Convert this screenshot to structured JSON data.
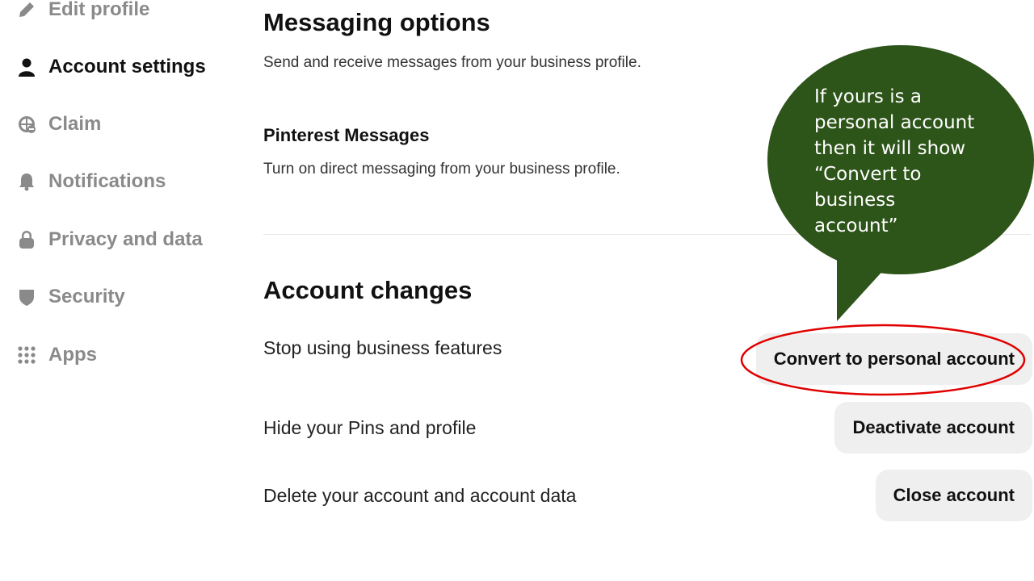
{
  "sidebar": {
    "items": [
      {
        "label": "Edit profile",
        "icon": "pencil-icon",
        "active": false
      },
      {
        "label": "Account settings",
        "icon": "person-icon",
        "active": true
      },
      {
        "label": "Claim",
        "icon": "globe-icon",
        "active": false
      },
      {
        "label": "Notifications",
        "icon": "bell-icon",
        "active": false
      },
      {
        "label": "Privacy and data",
        "icon": "lock-icon",
        "active": false
      },
      {
        "label": "Security",
        "icon": "shield-icon",
        "active": false
      },
      {
        "label": "Apps",
        "icon": "grid-icon",
        "active": false
      }
    ]
  },
  "messaging": {
    "title": "Messaging options",
    "subtitle": "Send and receive messages from your business profile.",
    "pinterest_title": "Pinterest Messages",
    "pinterest_desc": "Turn on direct messaging from your business profile."
  },
  "account_changes": {
    "title": "Account changes",
    "rows": [
      {
        "label": "Stop using business features",
        "button": "Convert to personal account"
      },
      {
        "label": "Hide your Pins and profile",
        "button": "Deactivate account"
      },
      {
        "label": "Delete your account and account data",
        "button": "Close account"
      }
    ]
  },
  "callout": {
    "text": "If yours is a\npersonal account\nthen it will show\n“Convert to\nbusiness\naccount”",
    "fill": "#2d5419",
    "highlight_color": "#e00000"
  },
  "colors": {
    "button_bg": "#efefef",
    "inactive_text": "#8a8a8a",
    "active_text": "#111111"
  }
}
